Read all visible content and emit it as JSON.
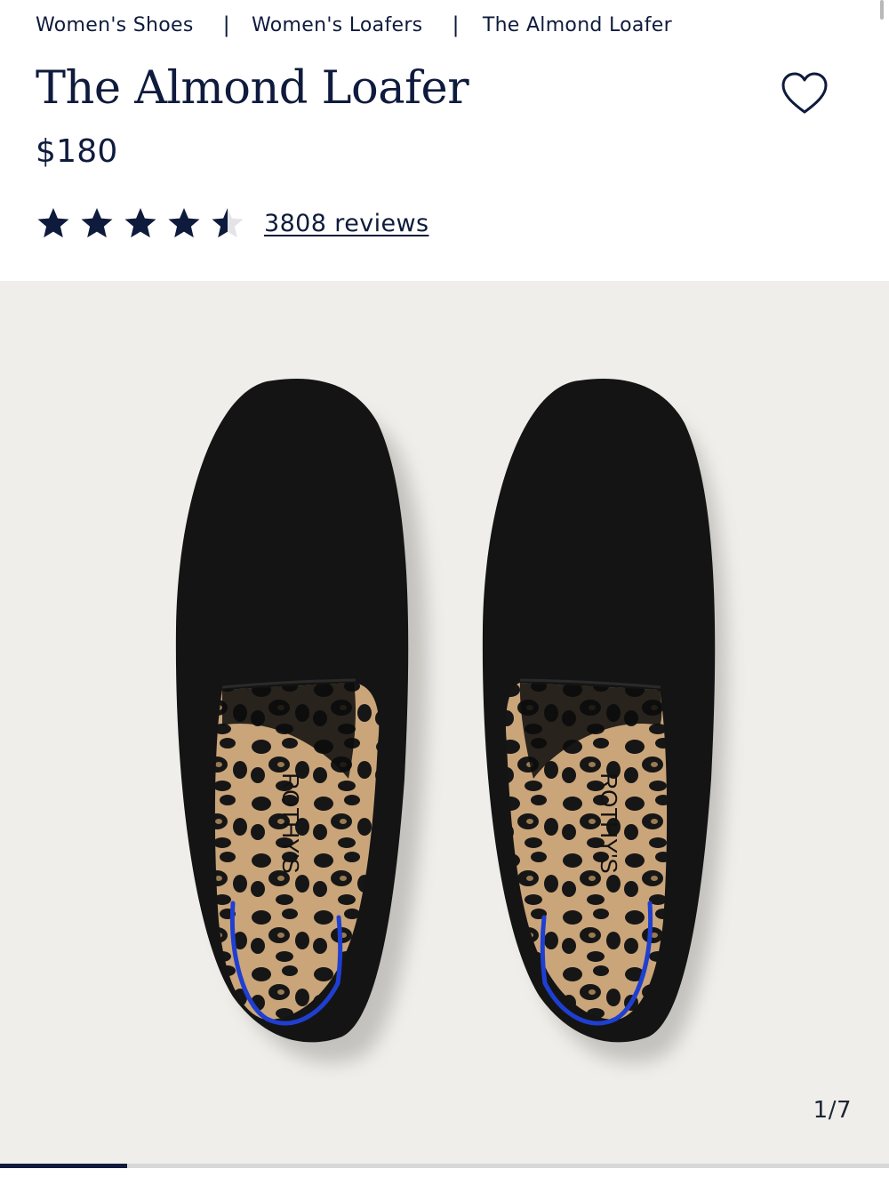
{
  "breadcrumb": {
    "items": [
      "Women's Shoes",
      "Women's Loafers",
      "The Almond Loafer"
    ],
    "separator": "|"
  },
  "product": {
    "title": "The Almond Loafer",
    "price": "$180",
    "rating": 4.5,
    "max_rating": 5,
    "reviews_label": "3808 reviews"
  },
  "gallery": {
    "counter": "1/7",
    "current": 1,
    "total": 7,
    "insole_brand": "ROTHY'S"
  },
  "icons": {
    "favorite": "heart-outline-icon",
    "star": "star-icon"
  },
  "colors": {
    "navy": "#0f1b3d",
    "gallery_bg": "#efeeea",
    "shoe": "#141414",
    "trim_blue": "#1f3fd1",
    "insole_tan": "#c9a67c"
  }
}
